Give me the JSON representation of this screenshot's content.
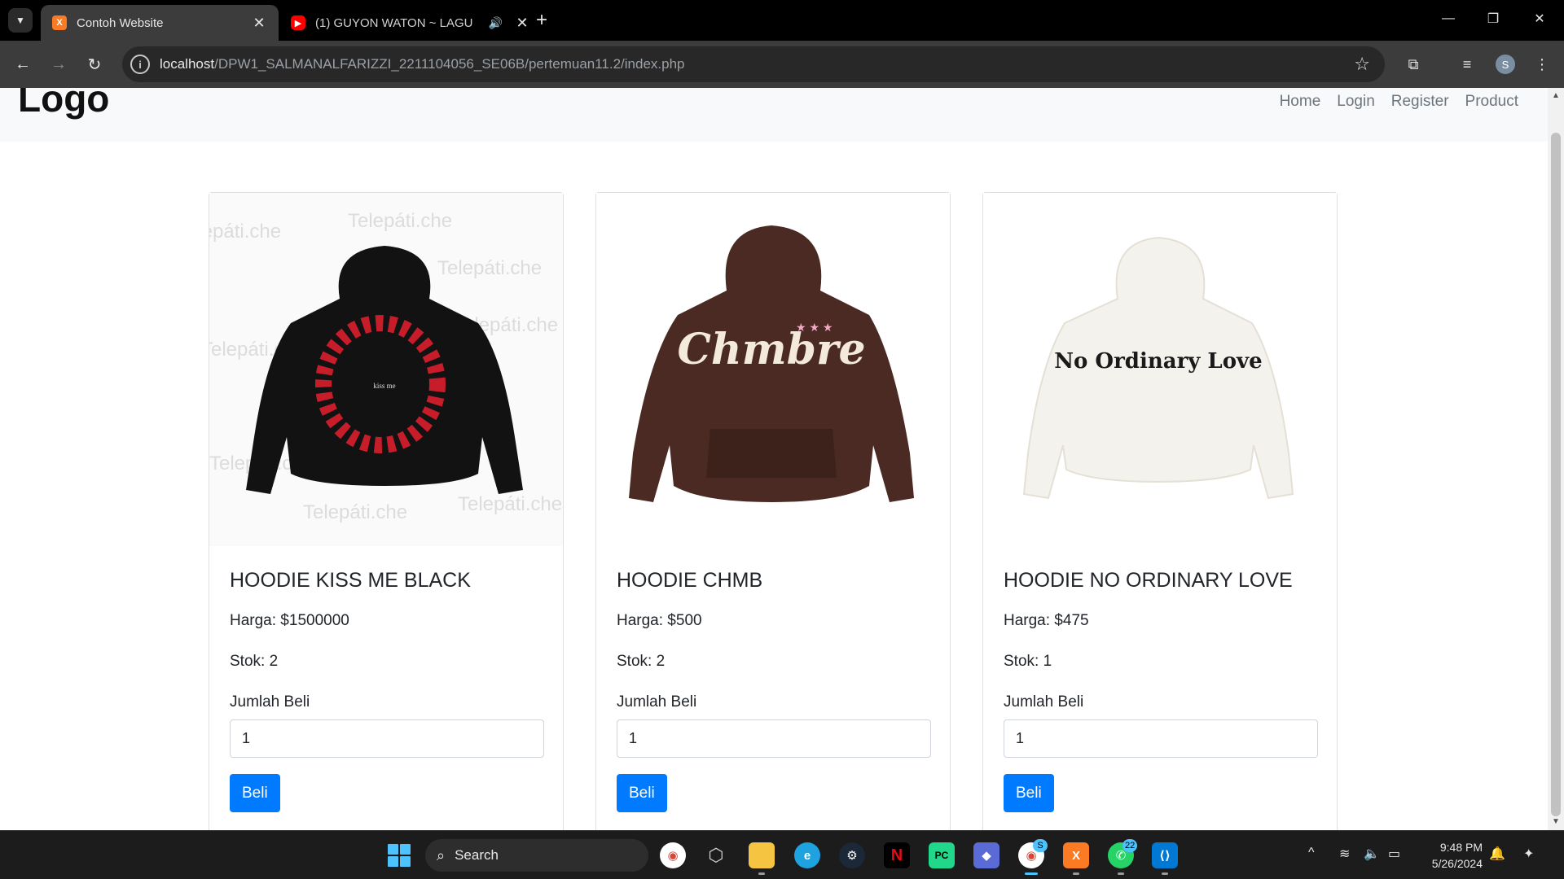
{
  "browser": {
    "tabs": [
      {
        "title": "Contoh Website",
        "active": true,
        "icon": "xampp-icon"
      },
      {
        "title": "(1) GUYON WATON ~ LAGU",
        "active": false,
        "icon": "youtube-icon"
      }
    ],
    "url_host": "localhost",
    "url_path": "/DPW1_SALMANALFARIZZI_2211104056_SE06B/pertemuan11.2/index.php",
    "profile_initial": "S"
  },
  "site": {
    "logo": "Logo",
    "nav": [
      "Home",
      "Login",
      "Register",
      "Product"
    ]
  },
  "products": [
    {
      "name": "HOODIE KISS ME BLACK",
      "price": "Harga: $1500000",
      "stock": "Stok: 2",
      "qty_label": "Jumlah Beli",
      "qty_value": "1",
      "buy_label": "Beli",
      "hoodie_color": "#121212",
      "print_text": "kiss me"
    },
    {
      "name": "HOODIE CHMB",
      "price": "Harga: $500",
      "stock": "Stok: 2",
      "qty_label": "Jumlah Beli",
      "qty_value": "1",
      "buy_label": "Beli",
      "hoodie_color": "#4a2a22",
      "print_text": "Chmbre"
    },
    {
      "name": "HOODIE NO ORDINARY LOVE",
      "price": "Harga: $475",
      "stock": "Stok: 1",
      "qty_label": "Jumlah Beli",
      "qty_value": "1",
      "buy_label": "Beli",
      "hoodie_color": "#f4f2ec",
      "print_text": "No Ordinary Love"
    }
  ],
  "watermark": "Telepáti.che",
  "taskbar": {
    "search": "Search",
    "time": "9:48 PM",
    "date": "5/26/2024",
    "whatsapp_badge": "22",
    "chrome_badge": "S"
  },
  "colors": {
    "primary": "#007bff",
    "nav_bg": "#f8f9fa",
    "chrome_dark": "#3c3c3c"
  }
}
